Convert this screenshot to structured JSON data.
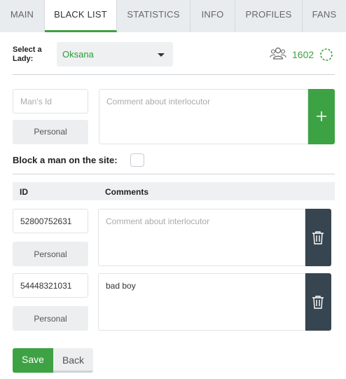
{
  "tabs": [
    {
      "label": "MAIN"
    },
    {
      "label": "BLACK LIST"
    },
    {
      "label": "STATISTICS"
    },
    {
      "label": "INFO"
    },
    {
      "label": "PROFILES"
    },
    {
      "label": "FANS"
    }
  ],
  "active_tab": "BLACK LIST",
  "lady_select": {
    "label": "Select a Lady:",
    "value": "Oksana"
  },
  "stats": {
    "count": "1602"
  },
  "new_entry": {
    "man_id_placeholder": "Man's Id",
    "comment_placeholder": "Comment about interlocutor",
    "personal_label": "Personal"
  },
  "block_label": "Block a man on the site:",
  "table": {
    "headers": [
      "ID",
      "Comments"
    ],
    "rows": [
      {
        "id": "52800752631",
        "comment": "",
        "comment_placeholder": "Comment about interlocutor",
        "personal_label": "Personal"
      },
      {
        "id": "54448321031",
        "comment": "bad boy",
        "comment_placeholder": "Comment about interlocutor",
        "personal_label": "Personal"
      }
    ]
  },
  "actions": {
    "save": "Save",
    "back": "Back"
  },
  "colors": {
    "accent": "#3da244",
    "dark": "#374550"
  }
}
